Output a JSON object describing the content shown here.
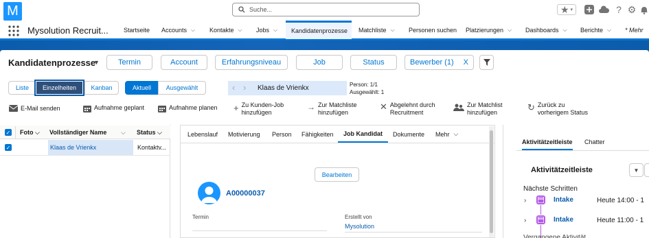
{
  "app": {
    "logo_letter": "M",
    "name": "Mysolution Recruit...",
    "search_placeholder": "Suche..."
  },
  "nav": {
    "tabs": [
      {
        "label": "Startseite"
      },
      {
        "label": "Accounts"
      },
      {
        "label": "Kontakte"
      },
      {
        "label": "Jobs"
      },
      {
        "label": "Kandidatenprozesse"
      },
      {
        "label": "Matchliste"
      },
      {
        "label": "Personen suchen"
      },
      {
        "label": "Platzierungen"
      },
      {
        "label": "Dashboards"
      },
      {
        "label": "Berichte"
      },
      {
        "label": "* Mehr"
      }
    ]
  },
  "header": {
    "title": "Kandidatenprozesse",
    "filters": [
      "Termin",
      "Account",
      "Erfahrungsniveau",
      "Job",
      "Status"
    ],
    "bewerber": "Bewerber (1)",
    "bewerber_clear": "X"
  },
  "views": {
    "liste": "Liste",
    "einzelheiten": "Einzelheiten",
    "kanban": "Kanban",
    "aktuell": "Aktuell",
    "ausgewaehlt": "Ausgewählt"
  },
  "record": {
    "name": "Klaas de Vrienkx",
    "person_count": "Person: 1/1",
    "selected_count": "Ausgewählt: 1"
  },
  "actions": [
    {
      "label": "E-Mail senden"
    },
    {
      "label": "Aufnahme geplant"
    },
    {
      "label": "Aufnahme planen"
    },
    {
      "label": "Zu Kunden-Job hinzufügen"
    },
    {
      "label": "Zur Matchliste hinzufügen"
    },
    {
      "label": "Abgelehnt durch Recruitment"
    },
    {
      "label": "Zur Matchlist hinzufügen"
    },
    {
      "label": "Zurück zu vorherigem Status"
    }
  ],
  "list": {
    "columns": [
      "Foto",
      "Vollständiger Name",
      "Status"
    ],
    "rows": [
      {
        "name": "Klaas de Vrienkx",
        "status": "Kontaktv..."
      }
    ]
  },
  "detail": {
    "tabs": [
      "Lebenslauf",
      "Motivierung",
      "Person",
      "Fähigkeiten",
      "Job Kandidat",
      "Dokumente",
      "Mehr"
    ],
    "edit_button": "Bearbeiten",
    "record_id": "A00000037",
    "fields": {
      "termin_label": "Termin",
      "erstellt_label": "Erstellt von",
      "erstellt_value": "Mysolution"
    }
  },
  "activity": {
    "tabs": [
      "Aktivitätzeitleiste",
      "Chatter"
    ],
    "heading": "Aktivitätzeitleiste",
    "next_steps": "Nächste Schritten",
    "items": [
      {
        "title": "Intake",
        "time": "Heute 14:00 - 1"
      },
      {
        "title": "Intake",
        "time": "Heute 11:00 - 1"
      }
    ],
    "footer": "Vergangene Aktivität"
  },
  "colors": {
    "brand": "#0176d3",
    "band": "#0b5cab",
    "milestone": "#b459e6"
  }
}
